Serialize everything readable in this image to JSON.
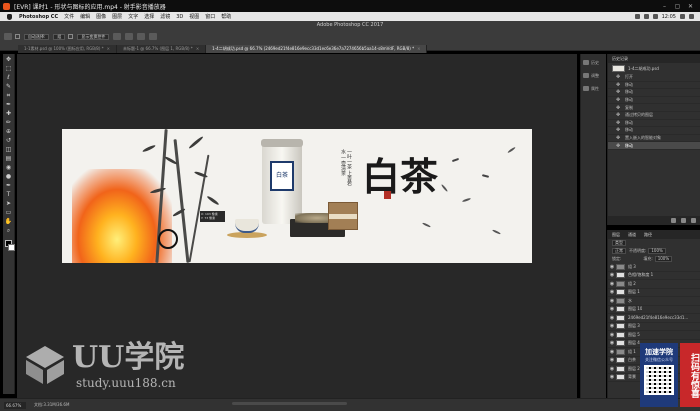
{
  "player": {
    "title": "[EVR] 课时1 - 形状与图标的应用.mp4 - 射手影音播放器",
    "controls": [
      "–",
      "▢",
      "✕"
    ]
  },
  "menubar": {
    "app_name": "Photoshop CC",
    "items": [
      "文件",
      "编辑",
      "图像",
      "图层",
      "文字",
      "选择",
      "滤镜",
      "3D",
      "视图",
      "窗口",
      "帮助"
    ],
    "clock": "12:05"
  },
  "options": {
    "app_title": "Adobe Photoshop CC 2017",
    "field1": "自动选择:",
    "field2": "组",
    "field3": "显示变换控件"
  },
  "tabs": [
    {
      "label": "1-1素材.psd @ 100% (图标应用, RGB/8) *",
      "active": false
    },
    {
      "label": "未标题-1 @ 66.7% (图层 1, RGB/8) *",
      "active": false
    },
    {
      "label": "1-4二胡成功.psd @ 66.7% (2469ed21f4e816e9ecc33d1ec6e36e7a7274656b5aa14-s8mVdF, RGB/8) *",
      "active": true
    }
  ],
  "toolbox": {
    "tools": [
      "move-tool",
      "marquee-tool",
      "lasso-tool",
      "quick-select-tool",
      "crop-tool",
      "eyedropper-tool",
      "healing-tool",
      "brush-tool",
      "stamp-tool",
      "history-brush-tool",
      "eraser-tool",
      "gradient-tool",
      "blur-tool",
      "dodge-tool",
      "pen-tool",
      "type-tool",
      "path-select-tool",
      "shape-tool",
      "hand-tool",
      "zoom-tool"
    ],
    "glyphs": [
      "✥",
      "⬚",
      "ℓ",
      "✎",
      "⌗",
      "✒",
      "✚",
      "✏",
      "⊕",
      "↺",
      "◫",
      "▤",
      "◉",
      "●",
      "✒",
      "T",
      "➤",
      "▭",
      "✋",
      "⌕"
    ],
    "fg_color": "#000000",
    "bg_color": "#ffffff"
  },
  "artwork": {
    "can_label": "白茶",
    "calligraphy_big": "白茶",
    "calligraphy_small": "一叶一茶 上善若水 一壶清茶"
  },
  "cursor_tip": {
    "line1": "X: 193 像素",
    "line2": "Y: 73 像素"
  },
  "panel_icons": [
    {
      "icon": "history-panel-icon",
      "label": "历史"
    },
    {
      "icon": "adjust-panel-icon",
      "label": "调整"
    },
    {
      "icon": "properties-panel-icon",
      "label": "属性"
    }
  ],
  "history": {
    "tab": "历史记录",
    "snapshot_name": "1-4二胡成功.psd",
    "items": [
      {
        "label": "打开",
        "icon": "open-state-icon",
        "active": false
      },
      {
        "label": "移动",
        "icon": "move-state-icon",
        "active": false
      },
      {
        "label": "移动",
        "icon": "move-state-icon",
        "active": false
      },
      {
        "label": "移动",
        "icon": "move-state-icon",
        "active": false
      },
      {
        "label": "复制",
        "icon": "duplicate-state-icon",
        "active": false
      },
      {
        "label": "通过拷贝的图层",
        "icon": "layer-copy-state-icon",
        "active": false
      },
      {
        "label": "移动",
        "icon": "move-state-icon",
        "active": false
      },
      {
        "label": "移动",
        "icon": "move-state-icon",
        "active": false
      },
      {
        "label": "置入嵌入的智能对象",
        "icon": "place-state-icon",
        "active": false
      },
      {
        "label": "移动",
        "icon": "move-state-icon",
        "active": true
      }
    ]
  },
  "layers": {
    "tabs": [
      "图层",
      "通道",
      "路径"
    ],
    "kind_label": "类型",
    "blend_mode": "正常",
    "opacity_label": "不透明度:",
    "opacity_value": "100%",
    "lock_label": "锁定:",
    "fill_label": "填充:",
    "fill_value": "100%",
    "items": [
      {
        "name": "组 3",
        "kind": "folder"
      },
      {
        "name": "色相/饱和度 1",
        "kind": "adjust"
      },
      {
        "name": "组 2",
        "kind": "folder"
      },
      {
        "name": "图层 1",
        "kind": "layer"
      },
      {
        "name": "水",
        "kind": "folder"
      },
      {
        "name": "图层 10",
        "kind": "layer"
      },
      {
        "name": "2469ed21f4e816e9ecc33d1...",
        "kind": "layer"
      },
      {
        "name": "图层 3",
        "kind": "layer"
      },
      {
        "name": "图层 5",
        "kind": "layer"
      },
      {
        "name": "图层 4",
        "kind": "layer"
      },
      {
        "name": "组 1",
        "kind": "folder"
      },
      {
        "name": "白茶",
        "kind": "text"
      },
      {
        "name": "图层 2",
        "kind": "layer"
      },
      {
        "name": "背景",
        "kind": "layer"
      }
    ]
  },
  "status": {
    "zoom": "66.67%",
    "doc_info": "文档:3.31M/36.6M"
  },
  "watermark": {
    "title": "UU学院",
    "url": "study.uuu188.cn"
  },
  "promo": {
    "line1": "加速学院",
    "line2": "关注微信公众号",
    "banner": "扫码有惊喜"
  }
}
